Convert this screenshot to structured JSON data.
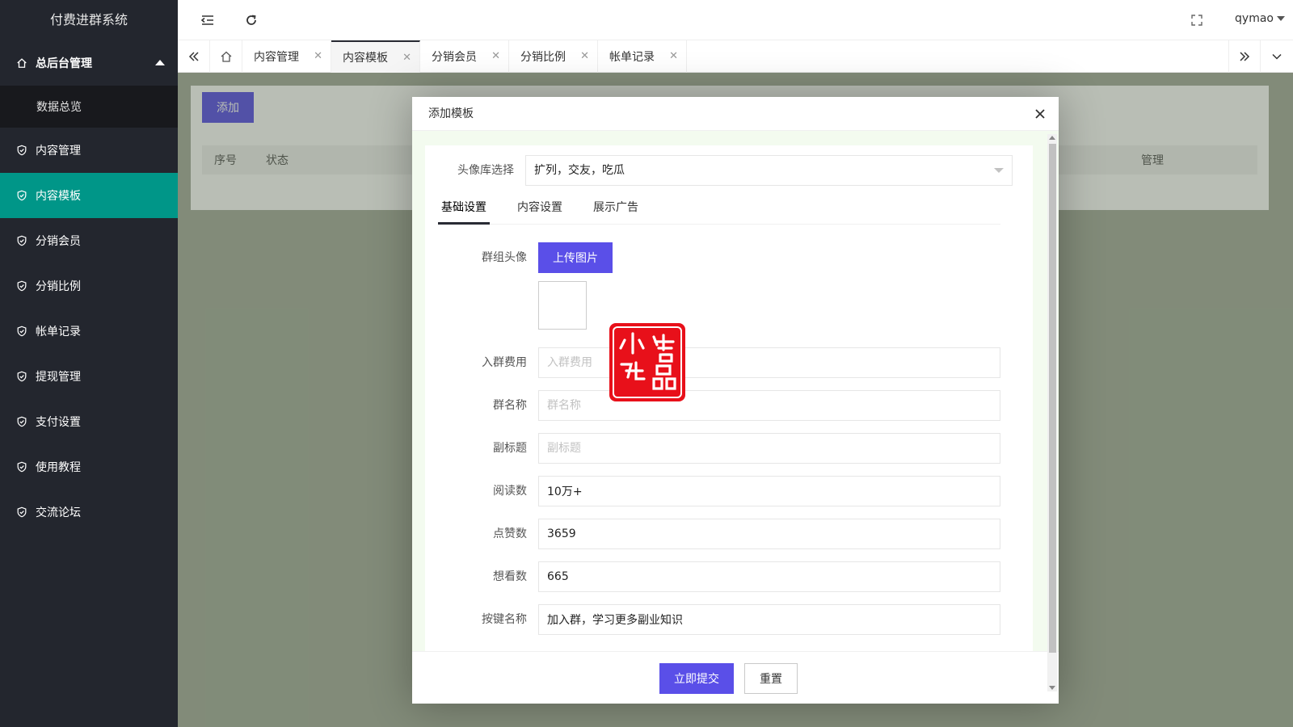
{
  "app": {
    "title": "付费进群系统"
  },
  "sidebar": {
    "group": {
      "label": "总后台管理",
      "icon": "home-icon"
    },
    "sub_items": [
      {
        "label": "数据总览"
      }
    ],
    "items": [
      {
        "label": "内容管理",
        "icon": "shield-check-icon"
      },
      {
        "label": "内容模板",
        "icon": "shield-check-icon",
        "active": true
      },
      {
        "label": "分销会员",
        "icon": "shield-check-icon"
      },
      {
        "label": "分销比例",
        "icon": "shield-check-icon"
      },
      {
        "label": "帐单记录",
        "icon": "shield-check-icon"
      },
      {
        "label": "提现管理",
        "icon": "shield-check-icon"
      },
      {
        "label": "支付设置",
        "icon": "shield-check-icon"
      },
      {
        "label": "使用教程",
        "icon": "shield-check-icon"
      },
      {
        "label": "交流论坛",
        "icon": "shield-check-icon"
      }
    ]
  },
  "header": {
    "user": "qymao"
  },
  "tabs": [
    {
      "label": "内容管理"
    },
    {
      "label": "内容模板",
      "active": true
    },
    {
      "label": "分销会员"
    },
    {
      "label": "分销比例"
    },
    {
      "label": "帐单记录"
    }
  ],
  "main": {
    "add_label": "添加",
    "columns": [
      "序号",
      "状态",
      "管理"
    ]
  },
  "modal": {
    "title": "添加模板",
    "avatar_lib": {
      "label": "头像库选择",
      "value": "扩列，交友，吃瓜"
    },
    "form_tabs": [
      "基础设置",
      "内容设置",
      "展示广告"
    ],
    "group_avatar": {
      "label": "群组头像",
      "upload_label": "上传图片"
    },
    "fields": [
      {
        "label": "入群费用",
        "placeholder": "入群费用",
        "value": ""
      },
      {
        "label": "群名称",
        "placeholder": "群名称",
        "value": ""
      },
      {
        "label": "副标题",
        "placeholder": "副标题",
        "value": ""
      },
      {
        "label": "阅读数",
        "placeholder": "",
        "value": "10万+"
      },
      {
        "label": "点赞数",
        "placeholder": "",
        "value": "3659"
      },
      {
        "label": "想看数",
        "placeholder": "",
        "value": "665"
      },
      {
        "label": "按键名称",
        "placeholder": "",
        "value": "加入群，学习更多副业知识"
      }
    ],
    "submit_label": "立即提交",
    "reset_label": "重置"
  },
  "watermark": {
    "text": "小码精品"
  },
  "colors": {
    "sidebar_bg": "#23262e",
    "active": "#009688",
    "primary": "#5a4fe8",
    "seal": "#e8101a"
  }
}
